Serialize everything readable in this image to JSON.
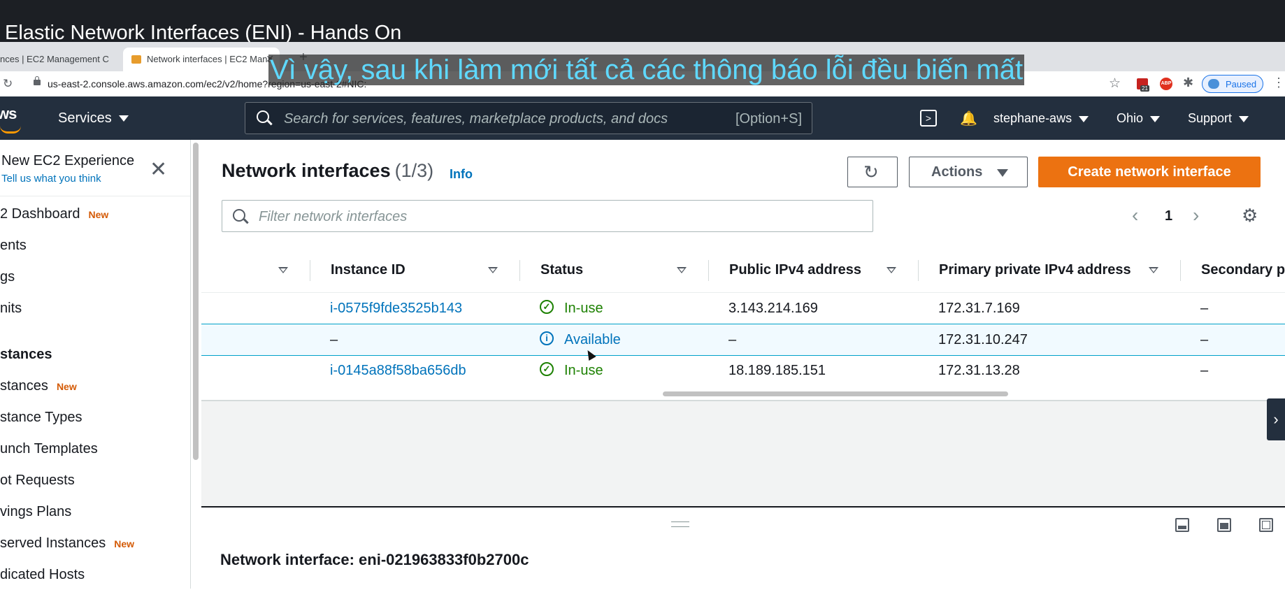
{
  "video": {
    "title": "Elastic Network Interfaces (ENI) - Hands On"
  },
  "subtitle": "Vì vậy, sau khi làm mới tất cả các thông báo lỗi đều biến mất",
  "browser": {
    "tabs": [
      {
        "label": "nces | EC2 Management C"
      },
      {
        "label": "Network interfaces | EC2 Mana"
      }
    ],
    "url": "us-east-2.console.aws.amazon.com/ec2/v2/home?region=us-east-2#NIC:",
    "profile_status": "Paused",
    "ext_badge": "21",
    "abp_label": "ABP"
  },
  "nav": {
    "logo": "ws",
    "services_label": "Services",
    "search_placeholder": "Search for services, features, marketplace products, and docs",
    "search_shortcut": "[Option+S]",
    "user": "stephane-aws",
    "region": "Ohio",
    "support": "Support"
  },
  "sidebar": {
    "new_experience": "New EC2 Experience",
    "tell_us": "Tell us what you think",
    "new_badge": "New",
    "items": [
      {
        "label": "2 Dashboard",
        "new": true
      },
      {
        "label": "ents"
      },
      {
        "label": "gs"
      },
      {
        "label": "nits"
      },
      {
        "label": "stances",
        "section": true
      },
      {
        "label": "stances",
        "new": true
      },
      {
        "label": "stance Types"
      },
      {
        "label": "unch Templates"
      },
      {
        "label": "ot Requests"
      },
      {
        "label": "vings Plans"
      },
      {
        "label": "served Instances",
        "new": true
      },
      {
        "label": "dicated Hosts"
      }
    ]
  },
  "main": {
    "title": "Network interfaces",
    "count": "(1/3)",
    "info": "Info",
    "actions_label": "Actions",
    "create_label": "Create network interface",
    "filter_placeholder": "Filter network interfaces",
    "page": "1",
    "columns": [
      "Instance ID",
      "Status",
      "Public IPv4 address",
      "Primary private IPv4 address",
      "Secondary p"
    ],
    "rows": [
      {
        "instance": "i-0575f9fde3525b143",
        "status": "In-use",
        "public_ip": "3.143.214.169",
        "private_ip": "172.31.7.169",
        "secondary": "–"
      },
      {
        "instance": "–",
        "status": "Available",
        "public_ip": "–",
        "private_ip": "172.31.10.247",
        "secondary": "–"
      },
      {
        "instance": "i-0145a88f58ba656db",
        "status": "In-use",
        "public_ip": "18.189.185.151",
        "private_ip": "172.31.13.28",
        "secondary": "–"
      }
    ],
    "detail_title": "Network interface: eni-021963833f0b2700c"
  },
  "colors": {
    "accent": "#ec7211",
    "nav_bg": "#232f3e",
    "link": "#0073bb",
    "success": "#1d8102",
    "subtitle": "#5fd9ff"
  }
}
